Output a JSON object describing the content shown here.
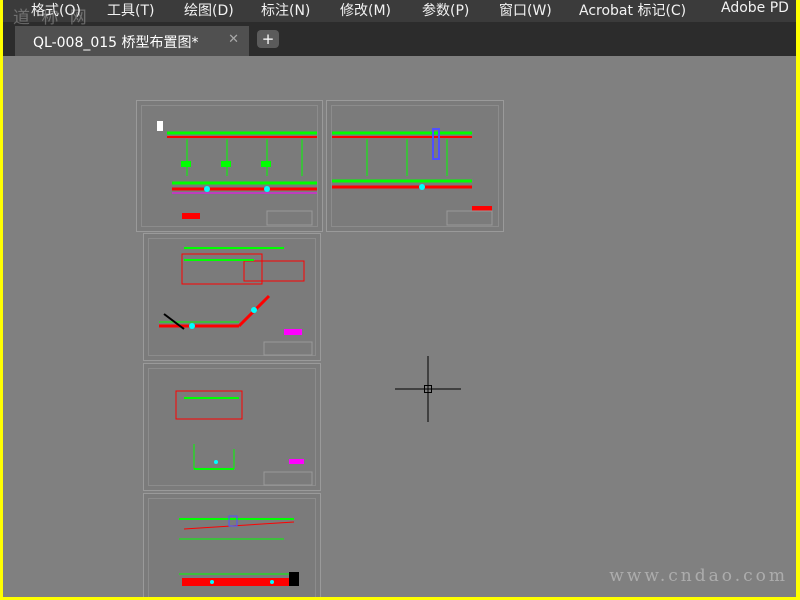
{
  "menu": [
    "格式(O)",
    "工具(T)",
    "绘图(D)",
    "标注(N)",
    "修改(M)",
    "参数(P)",
    "窗口(W)",
    "Acrobat 标记(C)",
    "Adobe PD"
  ],
  "tab": {
    "label": "QL-008_015 桥型布置图*",
    "close": "✕",
    "new": "+"
  },
  "watermark": {
    "logo": "道 称 网",
    "url": "www.cndao.com"
  },
  "colors": {
    "frame": "#ffff00",
    "canvas": "#808080",
    "green": "#00ff00",
    "red": "#ff0000",
    "magenta": "#ff00ff",
    "cyan": "#00ffff"
  }
}
